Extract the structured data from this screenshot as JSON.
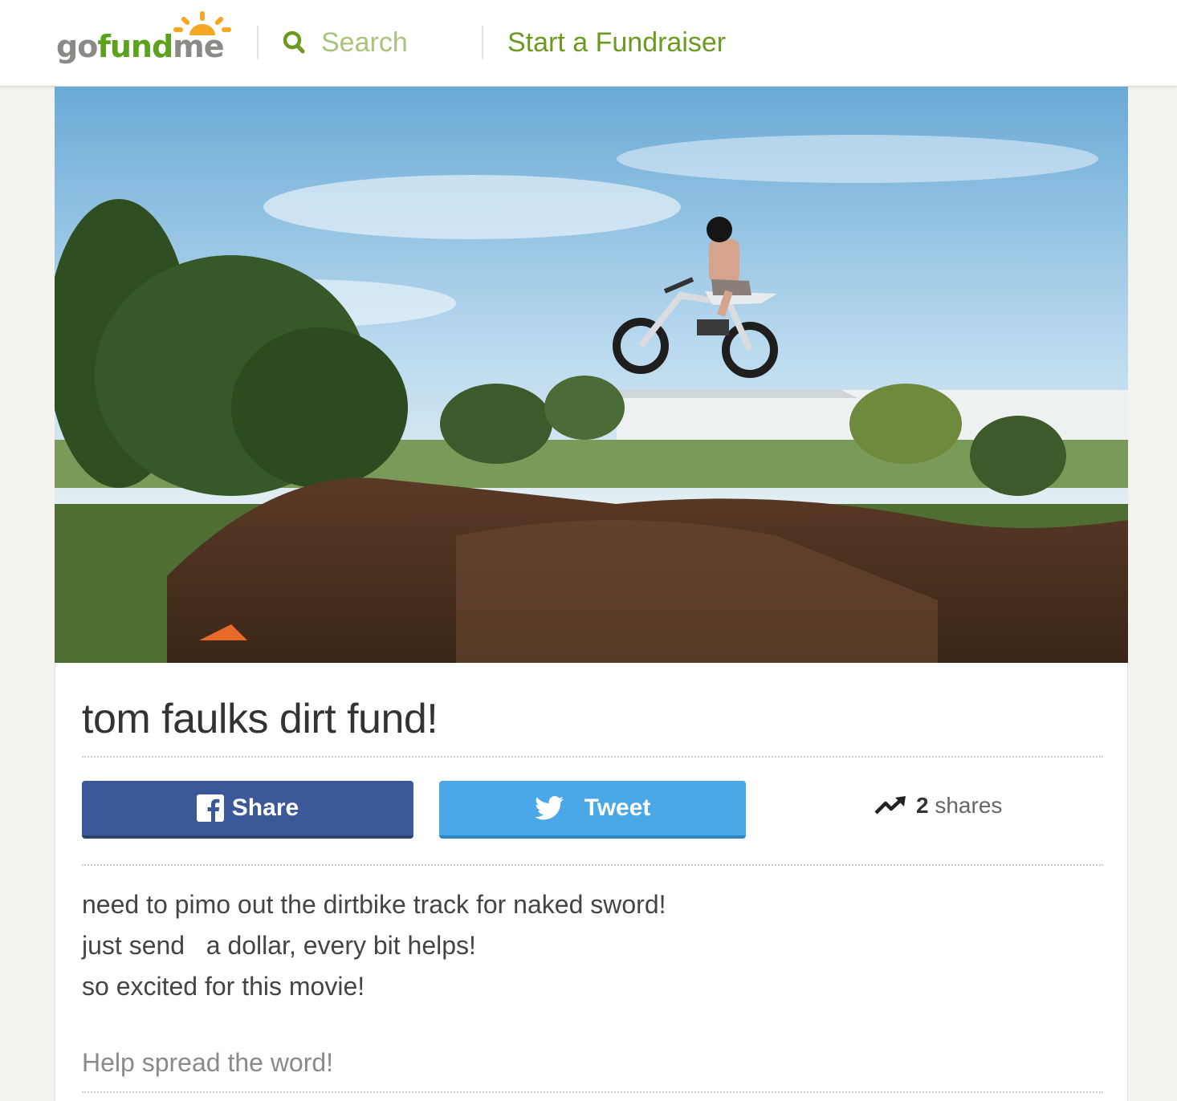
{
  "header": {
    "logo": {
      "go": "go",
      "fund": "fund",
      "me": "me"
    },
    "search": {
      "placeholder": "Search"
    },
    "start_link": "Start a Fundraiser"
  },
  "campaign": {
    "title": "tom faulks dirt fund!",
    "share_button": "Share",
    "tweet_button": "Tweet",
    "shares_count": "2",
    "shares_label": "shares",
    "description": [
      "need to pimo out the dirtbike track for naked sword!",
      "just send   a dollar, every bit helps!",
      "so excited for this movie!"
    ],
    "spread_prompt": "Help spread the word!"
  },
  "colors": {
    "brand_green": "#6b9a1f",
    "facebook": "#3b5998",
    "twitter": "#4aa7e8"
  },
  "icons": [
    "gofundme-sun-icon",
    "search-icon",
    "facebook-icon",
    "twitter-icon",
    "trending-up-icon"
  ]
}
